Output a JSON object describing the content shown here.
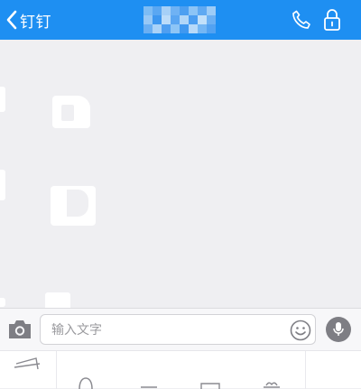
{
  "header": {
    "back_label": "钉钉",
    "background_color": "#1e8ff2",
    "icons": [
      "chevron-left-icon",
      "phone-icon",
      "lock-icon"
    ],
    "mosaic_colors": [
      [
        "#7cbcf5",
        "#5aa7f2",
        "#a6d0f7",
        "#6fb2f4",
        "#4c9ff1",
        "#8cc4f6",
        "#5fa9f2",
        "#9dccf7"
      ],
      [
        "#97c8f6",
        "#3d97f0",
        "#bcdcf9",
        "#5aa6f2",
        "#b0d6f8",
        "#4a9df1",
        "#c2e0fa",
        "#6cb0f3"
      ],
      [
        "#6aaff3",
        "#a9d2f8",
        "#4f9ff1",
        "#8dc5f6",
        "#3f98f0",
        "#b7d9f9",
        "#74b6f4",
        "#52a2f2"
      ]
    ]
  },
  "input_bar": {
    "placeholder": "输入文字",
    "icons": [
      "camera-icon",
      "emoji-icon",
      "microphone-icon"
    ]
  },
  "toolbar": {
    "icons": [
      "image-icon",
      "location-icon",
      "file-icon",
      "gift-icon"
    ]
  }
}
